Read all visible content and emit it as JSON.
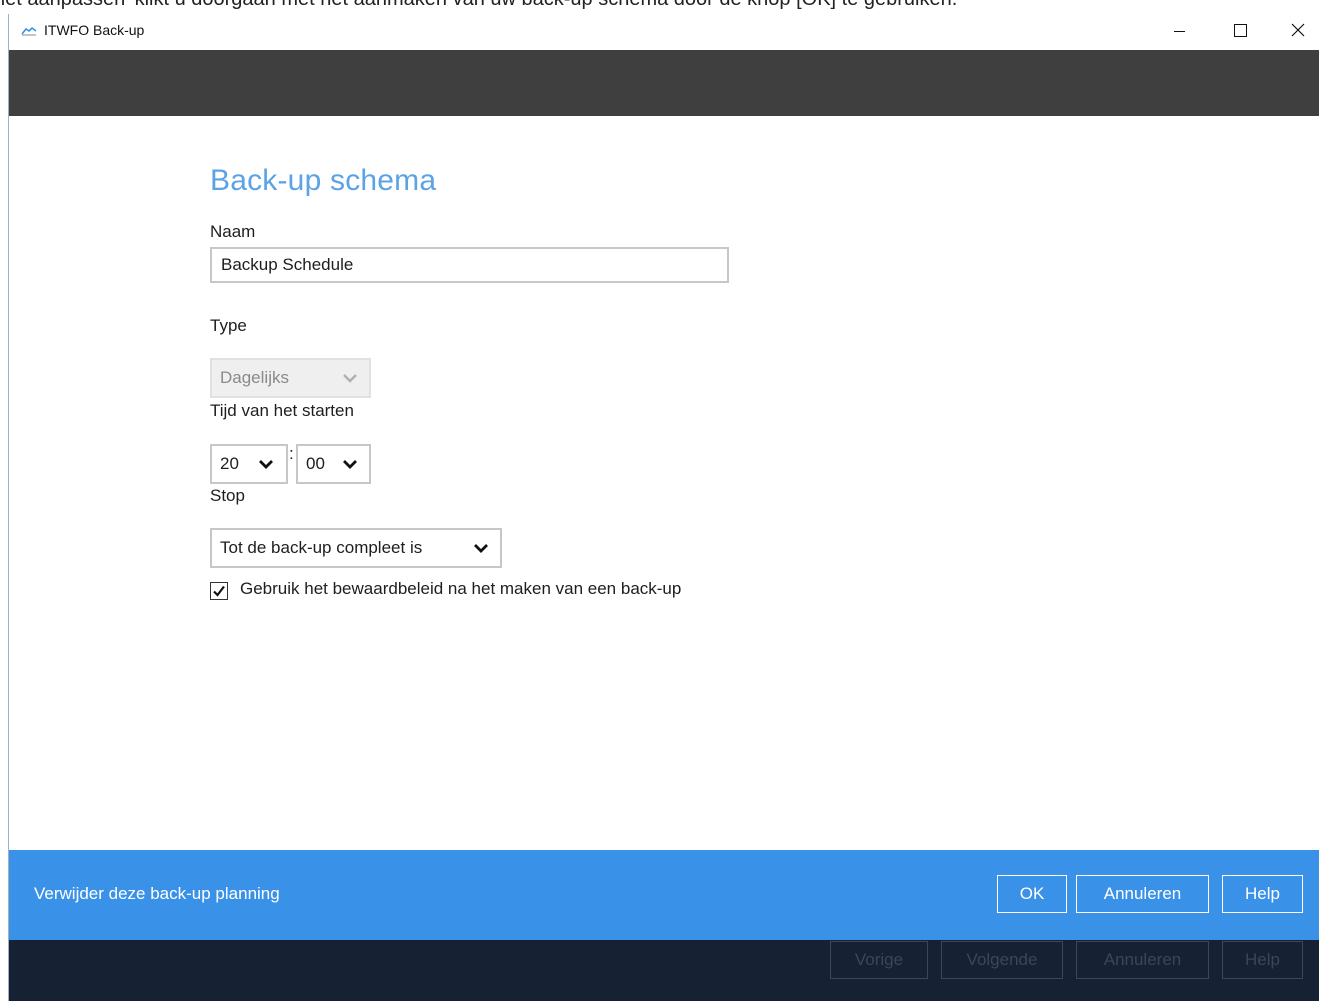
{
  "document_text": "het aanpassen' klikt u doorgaan met het aanmaken van uw back-up schema door de knop [OK] te gebruiken.",
  "window": {
    "title": "ITWFO Back-up",
    "minimize_icon": "minimize-icon",
    "maximize_icon": "maximize-icon",
    "close_icon": "close-icon"
  },
  "form": {
    "title": "Back-up schema",
    "name_label": "Naam",
    "name_value": "Backup Schedule",
    "type_label": "Type",
    "type_value": "Dagelijks",
    "start_label": "Tijd van het starten",
    "start_hour": "20",
    "start_separator": ":",
    "start_minute": "00",
    "stop_label": "Stop",
    "stop_value": "Tot de back-up compleet is",
    "retention_checked": true,
    "retention_label": "Gebruik het bewaardbeleid na het maken van een back-up"
  },
  "action_bar": {
    "delete_label": "Verwijder deze back-up planning",
    "ok_label": "OK",
    "cancel_label": "Annuleren",
    "help_label": "Help"
  },
  "nav_bar": {
    "previous_label": "Vorige",
    "next_label": "Volgende",
    "cancel_label": "Annuleren",
    "help_label": "Help"
  },
  "colors": {
    "accent": "#5ba3e6",
    "action_bar": "#3a92e8",
    "header_band": "#3f3f3f",
    "nav_bar": "#162233"
  }
}
